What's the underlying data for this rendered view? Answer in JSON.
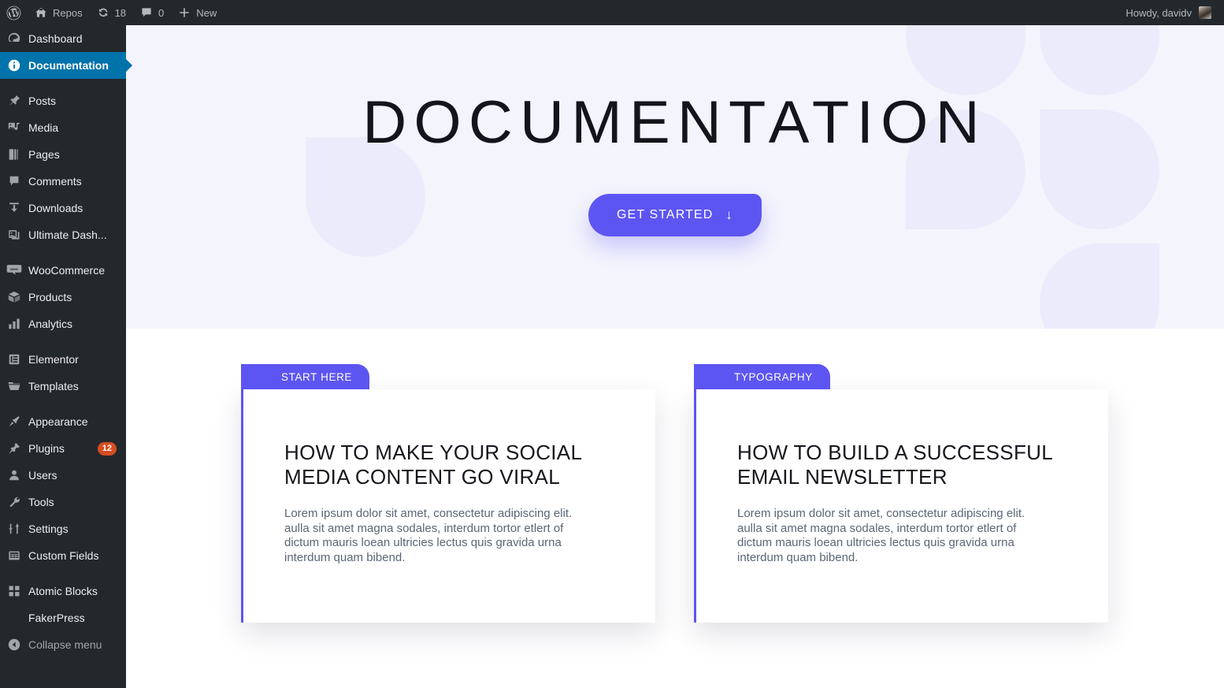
{
  "colors": {
    "accent": "#5d55f2",
    "hero_bg": "#f4f4fd",
    "petal": "#ecebfb",
    "admin_bg": "#23282d",
    "current_menu": "#0073aa",
    "badge": "#d54e21"
  },
  "adminbar": {
    "site_name": "Repos",
    "updates_count": "18",
    "comments_count": "0",
    "new_label": "New",
    "howdy": "Howdy, davidv"
  },
  "sidebar": {
    "items": [
      {
        "label": "Dashboard",
        "icon": "dashboard-icon",
        "current": false
      },
      {
        "label": "Documentation",
        "icon": "info-icon",
        "current": true
      },
      {
        "label": "Posts",
        "icon": "pin-icon",
        "current": false
      },
      {
        "label": "Media",
        "icon": "media-icon",
        "current": false
      },
      {
        "label": "Pages",
        "icon": "pages-icon",
        "current": false
      },
      {
        "label": "Comments",
        "icon": "comment-icon",
        "current": false
      },
      {
        "label": "Downloads",
        "icon": "download-icon",
        "current": false
      },
      {
        "label": "Ultimate Dash...",
        "icon": "images-icon",
        "current": false
      },
      {
        "label": "WooCommerce",
        "icon": "woo-icon",
        "current": false
      },
      {
        "label": "Products",
        "icon": "box-icon",
        "current": false
      },
      {
        "label": "Analytics",
        "icon": "bars-icon",
        "current": false
      },
      {
        "label": "Elementor",
        "icon": "elementor-icon",
        "current": false
      },
      {
        "label": "Templates",
        "icon": "folder-icon",
        "current": false
      },
      {
        "label": "Appearance",
        "icon": "brush-icon",
        "current": false
      },
      {
        "label": "Plugins",
        "icon": "plug-icon",
        "current": false,
        "badge": "12"
      },
      {
        "label": "Users",
        "icon": "user-icon",
        "current": false
      },
      {
        "label": "Tools",
        "icon": "wrench-icon",
        "current": false
      },
      {
        "label": "Settings",
        "icon": "sliders-icon",
        "current": false
      },
      {
        "label": "Custom Fields",
        "icon": "table-icon",
        "current": false
      },
      {
        "label": "Atomic Blocks",
        "icon": "blocks-icon",
        "current": false
      },
      {
        "label": "FakerPress",
        "icon": "",
        "current": false
      },
      {
        "label": "Collapse menu",
        "icon": "collapse-icon",
        "current": false
      }
    ]
  },
  "hero": {
    "title": "DOCUMENTATION",
    "cta_label": "GET STARTED",
    "cta_arrow": "↓"
  },
  "cards": [
    {
      "badge": "START HERE",
      "title": "HOW TO MAKE YOUR SOCIAL MEDIA CONTENT GO VIRAL",
      "text": "Lorem ipsum dolor sit amet, consectetur adipiscing elit. aulla sit amet magna sodales, interdum tortor etlert of dictum mauris loean ultricies lectus quis gravida urna interdum quam bibend."
    },
    {
      "badge": "TYPOGRAPHY",
      "title": "HOW TO BUILD A SUCCESSFUL EMAIL NEWSLETTER",
      "text": "Lorem ipsum dolor sit amet, consectetur adipiscing elit. aulla sit amet magna sodales, interdum tortor etlert of dictum mauris loean ultricies lectus quis gravida urna interdum quam bibend."
    }
  ]
}
